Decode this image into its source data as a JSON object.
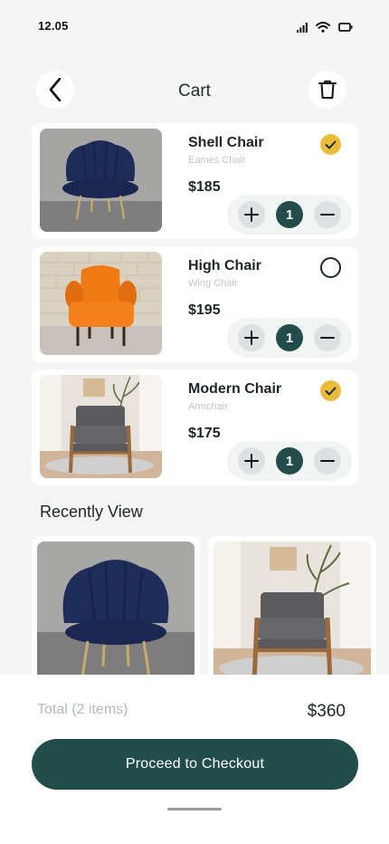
{
  "status_bar": {
    "time": "12.05"
  },
  "header": {
    "title": "Cart",
    "back_icon": "chevron-left-icon",
    "trash_icon": "trash-icon"
  },
  "cart": {
    "items": [
      {
        "name": "Shell Chair",
        "subtitle": "Eames Chair",
        "price": "$185",
        "quantity": "1",
        "selected": true,
        "image": "navy-velvet-shell-chair"
      },
      {
        "name": "High Chair",
        "subtitle": "Wing Chair",
        "price": "$195",
        "quantity": "1",
        "selected": false,
        "image": "orange-wing-chair"
      },
      {
        "name": "Modern Chair",
        "subtitle": "Armchair",
        "price": "$175",
        "quantity": "1",
        "selected": true,
        "image": "grey-wooden-armchair"
      }
    ]
  },
  "recent": {
    "title": "Recently View",
    "items": [
      {
        "image": "navy-velvet-shell-chair"
      },
      {
        "image": "grey-wooden-armchair"
      }
    ]
  },
  "summary": {
    "total_label": "Total (2 items)",
    "total_value": "$360",
    "checkout_label": "Proceed to Checkout"
  },
  "colors": {
    "accent": "#234d4b",
    "check": "#e9bc3c",
    "background": "#f5f5f5"
  }
}
